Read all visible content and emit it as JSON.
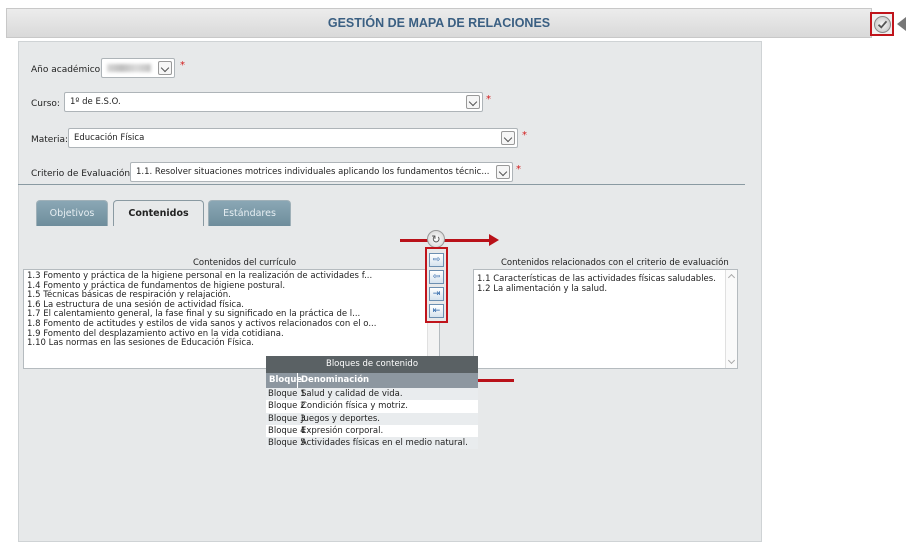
{
  "title": "GESTIÓN DE MAPA DE RELACIONES",
  "form": {
    "anio": {
      "label": "Año académico:",
      "value": ""
    },
    "curso": {
      "label": "Curso:",
      "value": "1º de E.S.O."
    },
    "materia": {
      "label": "Materia:",
      "value": "Educación Física"
    },
    "criterio": {
      "label": "Criterio de Evaluación:",
      "value": "1.1. Resolver situaciones motrices individuales aplicando los fundamentos técnic..."
    },
    "required_mark": "*"
  },
  "tabs": [
    {
      "label": "Objetivos",
      "active": false
    },
    {
      "label": "Contenidos",
      "active": true
    },
    {
      "label": "Estándares",
      "active": false
    }
  ],
  "curriculo": {
    "caption": "Contenidos del currículo",
    "items": [
      "1.3 Fomento y práctica de la higiene personal en la realización de actividades f...",
      "1.4 Fomento y práctica de fundamentos de higiene postural.",
      "1.5 Técnicas básicas de respiración y relajación.",
      "1.6 La estructura de una sesión de actividad física.",
      "1.7 El calentamiento general, la fase final y su significado en la práctica de l...",
      "1.8 Fomento de actitudes y estilos de vida sanos y activos relacionados con el o...",
      "1.9 Fomento del desplazamiento activo en la vida cotidiana.",
      "1.10 Las normas en las sesiones de Educación Física."
    ]
  },
  "relacionados": {
    "caption": "Contenidos relacionados con el criterio de evaluación",
    "items": [
      "1.1 Características de las actividades físicas saludables.",
      "1.2 La alimentación y la salud."
    ]
  },
  "bloques": {
    "caption": "Bloques de contenido",
    "headers": [
      "Bloque",
      "Denominación"
    ],
    "rows": [
      [
        "Bloque 1",
        "Salud y calidad de vida."
      ],
      [
        "Bloque 2",
        "Condición física y motriz."
      ],
      [
        "Bloque 3",
        "Juegos y deportes."
      ],
      [
        "Bloque 4",
        "Expresión corporal."
      ],
      [
        "Bloque 5",
        "Actividades físicas en el medio natural."
      ]
    ]
  },
  "icons": {
    "ok": "check-circle-icon",
    "refresh": "refresh-icon",
    "move_right": "move-right-icon",
    "move_left": "move-left-icon",
    "move_all_right": "move-all-right-icon",
    "move_all_left": "move-all-left-icon"
  },
  "colors": {
    "title": "#3a5f82",
    "accent_red": "#c0141b",
    "tab": "#7b98a7"
  }
}
